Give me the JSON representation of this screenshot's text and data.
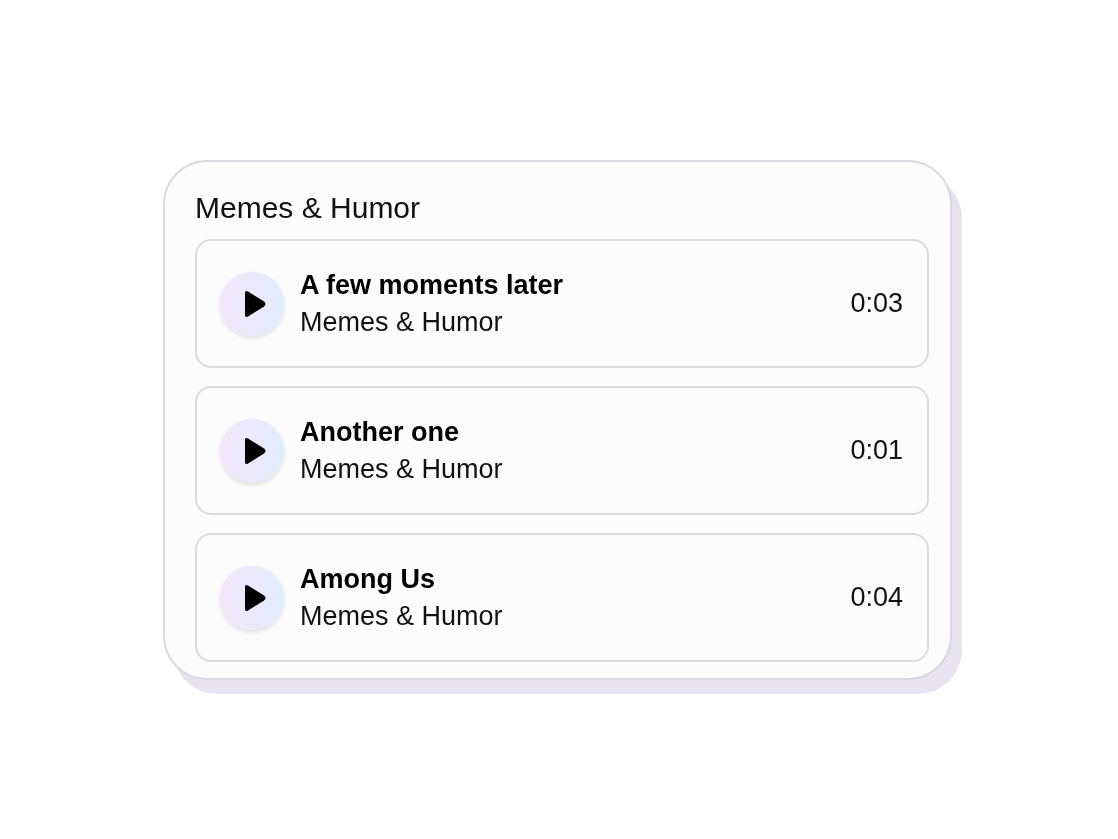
{
  "playlist": {
    "title": "Memes & Humor",
    "tracks": [
      {
        "title": "A few moments later",
        "subtitle": "Memes & Humor",
        "duration": "0:03"
      },
      {
        "title": "Another one",
        "subtitle": "Memes & Humor",
        "duration": "0:01"
      },
      {
        "title": "Among Us",
        "subtitle": "Memes & Humor",
        "duration": "0:04"
      }
    ]
  }
}
